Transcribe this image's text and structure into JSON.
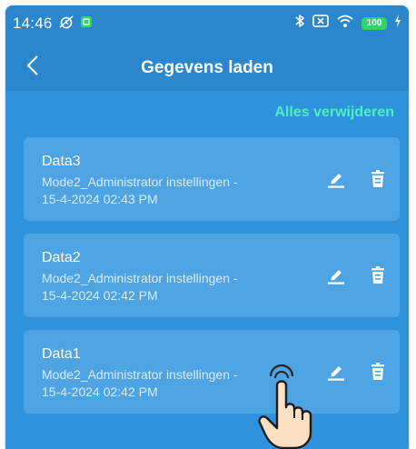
{
  "status_bar": {
    "time": "14:46",
    "battery": "100"
  },
  "header": {
    "title": "Gegevens laden"
  },
  "actions": {
    "delete_all": "Alles verwijderen"
  },
  "items": [
    {
      "name": "Data3",
      "desc_line1": "Mode2_Administrator instellingen -",
      "desc_line2": "15-4-2024 02:43 PM"
    },
    {
      "name": "Data2",
      "desc_line1": "Mode2_Administrator instellingen -",
      "desc_line2": "15-4-2024 02:42 PM"
    },
    {
      "name": "Data1",
      "desc_line1": "Mode2_Administrator instellingen -",
      "desc_line2": "15-4-2024 02:42 PM"
    }
  ],
  "icons": {
    "back": "chevron-left-icon",
    "edit": "pencil-icon",
    "delete": "trash-icon",
    "pointer": "tap-hand-icon"
  },
  "colors": {
    "background": "#2f92dc",
    "header": "#2b86cc",
    "card": "#4ea3e2",
    "accent": "#4ef0c0",
    "battery": "#33d36a"
  }
}
